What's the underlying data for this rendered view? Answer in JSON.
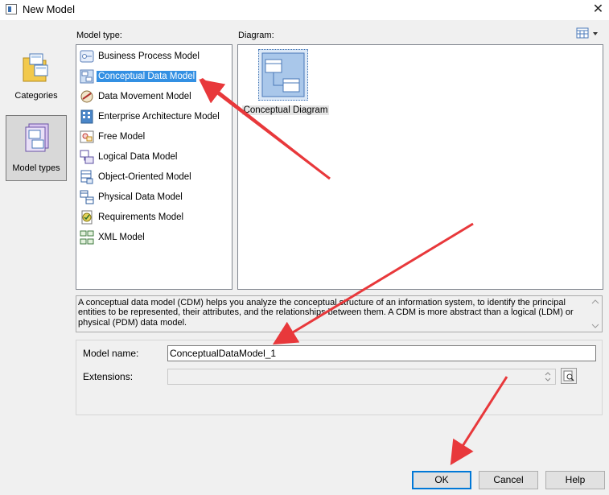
{
  "window": {
    "title": "New Model",
    "close_glyph": "✕"
  },
  "nav": {
    "items": [
      {
        "label": "Categories",
        "icon": "folder-models-icon",
        "selected": false
      },
      {
        "label": "Model types",
        "icon": "model-types-icon",
        "selected": true
      }
    ]
  },
  "labels": {
    "model_type": "Model type:",
    "diagram": "Diagram:"
  },
  "model_types": [
    {
      "label": "Business Process Model",
      "icon": "business-process-model-icon",
      "selected": false
    },
    {
      "label": "Conceptual Data Model",
      "icon": "conceptual-data-model-icon",
      "selected": true
    },
    {
      "label": "Data Movement Model",
      "icon": "data-movement-model-icon",
      "selected": false
    },
    {
      "label": "Enterprise Architecture Model",
      "icon": "enterprise-architecture-model-icon",
      "selected": false
    },
    {
      "label": "Free Model",
      "icon": "free-model-icon",
      "selected": false
    },
    {
      "label": "Logical Data Model",
      "icon": "logical-data-model-icon",
      "selected": false
    },
    {
      "label": "Object-Oriented Model",
      "icon": "object-oriented-model-icon",
      "selected": false
    },
    {
      "label": "Physical Data Model",
      "icon": "physical-data-model-icon",
      "selected": false
    },
    {
      "label": "Requirements Model",
      "icon": "requirements-model-icon",
      "selected": false
    },
    {
      "label": "XML Model",
      "icon": "xml-model-icon",
      "selected": false
    }
  ],
  "diagrams": [
    {
      "label": "Conceptual Diagram",
      "icon": "conceptual-diagram-icon",
      "selected": true
    }
  ],
  "description": "A conceptual data model (CDM) helps you analyze the conceptual structure of an information system, to identify the principal entities to be represented, their attributes, and the relationships between them. A CDM is more abstract than a logical (LDM) or physical (PDM) data model.",
  "form": {
    "model_name_label": "Model name:",
    "model_name_value": "ConceptualDataModel_1",
    "extensions_label": "Extensions:",
    "extensions_value": ""
  },
  "buttons": {
    "ok": "OK",
    "cancel": "Cancel",
    "help": "Help"
  },
  "colors": {
    "selection": "#3390e3",
    "annotation_arrow": "#e8383b",
    "ok_border": "#0078d7"
  }
}
